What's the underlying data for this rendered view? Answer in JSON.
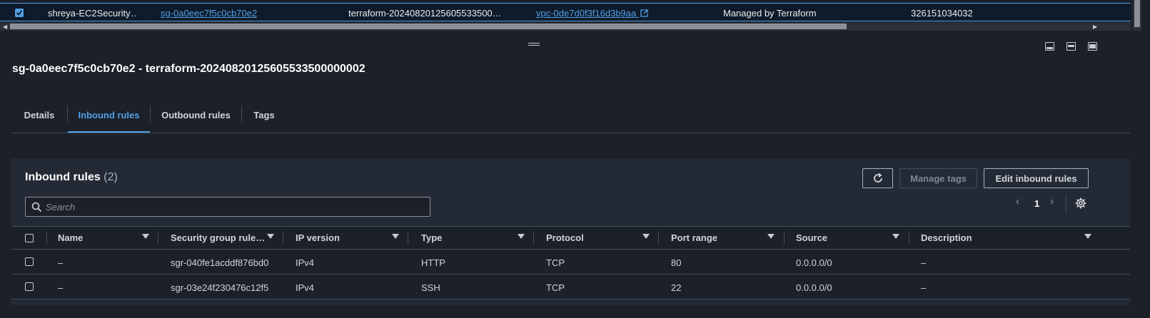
{
  "top_row": {
    "name": "shreya-EC2Security…",
    "sg_id": "sg-0a0eec7f5c0cb70e2",
    "group_name": "terraform-20240820125605533500…",
    "vpc_id": "vpc-0de7d0f3f16d3b9aa",
    "description": "Managed by Terraform",
    "owner": "326151034032"
  },
  "detail": {
    "title": "sg-0a0eec7f5c0cb70e2 - terraform-20240820125605533500000002"
  },
  "tabs": [
    {
      "label": "Details"
    },
    {
      "label": "Inbound rules"
    },
    {
      "label": "Outbound rules"
    },
    {
      "label": "Tags"
    }
  ],
  "inbound": {
    "title": "Inbound rules",
    "count": "(2)",
    "manage_tags_label": "Manage tags",
    "edit_label": "Edit inbound rules",
    "search_placeholder": "Search",
    "page": "1",
    "columns": [
      "Name",
      "Security group rule…",
      "IP version",
      "Type",
      "Protocol",
      "Port range",
      "Source",
      "Description"
    ],
    "rows": [
      {
        "name": "–",
        "rule_id": "sgr-040fe1acddf876bd0",
        "ip_version": "IPv4",
        "type": "HTTP",
        "protocol": "TCP",
        "port_range": "80",
        "source": "0.0.0.0/0",
        "description": "–"
      },
      {
        "name": "–",
        "rule_id": "sgr-03e24f230476c12f5",
        "ip_version": "IPv4",
        "type": "SSH",
        "protocol": "TCP",
        "port_range": "22",
        "source": "0.0.0.0/0",
        "description": "–"
      }
    ]
  },
  "colors": {
    "accent": "#539fe5",
    "background": "#1b2029",
    "panel": "#232a35"
  }
}
